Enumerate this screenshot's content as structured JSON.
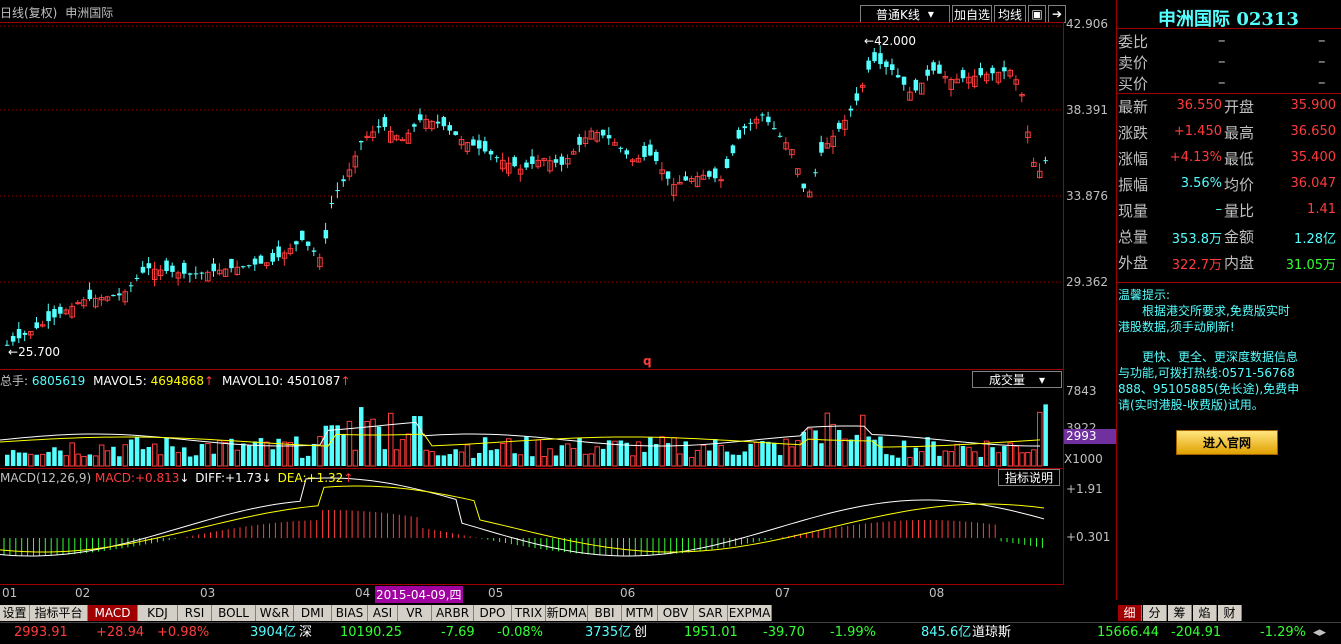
{
  "header": {
    "chart_title": "日线(复权)",
    "stock_name": "申洲国际",
    "kline_type": "普通K线",
    "add_watch": "加自选",
    "ma_line": "均线"
  },
  "price_axis": [
    "42.906",
    "38.391",
    "33.876",
    "29.362"
  ],
  "price_marks": {
    "high": "42.000",
    "low": "25.700"
  },
  "volume_pane": {
    "legend_prefix": "总手:",
    "total": "6805619",
    "mavol5_label": "MAVOL5:",
    "mavol5": "4694868",
    "mavol10_label": "MAVOL10:",
    "mavol10": "4501087",
    "dropdown": "成交量",
    "axis_top": "7843",
    "axis_mid": "3922",
    "axis_tag": "2993",
    "axis_unit": "X1000"
  },
  "macd_pane": {
    "legend_prefix": "MACD(12,26,9)",
    "macd_label": "MACD:",
    "macd": "+0.813",
    "diff_label": "DIFF:",
    "diff": "+1.73",
    "dea_label": "DEA:",
    "dea": "+1.32",
    "help_button": "指标说明",
    "axis_top": "+1.91",
    "axis_mid": "+0.301"
  },
  "x_axis": {
    "months": [
      "01",
      "02",
      "03",
      "04",
      "05",
      "06",
      "07",
      "08"
    ],
    "cursor_date": "2015-04-09,四"
  },
  "center_marker": "q",
  "indicator_tabs": [
    "设置",
    "指标平台",
    "MACD",
    "KDJ",
    "RSI",
    "BOLL",
    "W&R",
    "DMI",
    "BIAS",
    "ASI",
    "VR",
    "ARBR",
    "DPO",
    "TRIX",
    "新DMA",
    "BBI",
    "MTM",
    "OBV",
    "SAR",
    "EXPMA"
  ],
  "active_tab": "MACD",
  "right_tabs": [
    "细",
    "分",
    "筹",
    "焰",
    "财"
  ],
  "quote_panel": {
    "title": "申洲国际 02313",
    "weibi_label": "委比",
    "weibi": "–",
    "weibi2": "–",
    "sell_label": "卖价",
    "sell": "–",
    "sell2": "–",
    "buy_label": "买价",
    "buy": "–",
    "buy2": "–",
    "rows": [
      {
        "l1": "最新",
        "v1": "36.550",
        "c1": "red",
        "l2": "开盘",
        "v2": "35.900",
        "c2": "red"
      },
      {
        "l1": "涨跌",
        "v1": "+1.450",
        "c1": "red",
        "l2": "最高",
        "v2": "36.650",
        "c2": "red"
      },
      {
        "l1": "涨幅",
        "v1": "+4.13%",
        "c1": "red",
        "l2": "最低",
        "v2": "35.400",
        "c2": "red"
      },
      {
        "l1": "振幅",
        "v1": "3.56%",
        "c1": "cyan",
        "l2": "均价",
        "v2": "36.047",
        "c2": "red"
      },
      {
        "l1": "现量",
        "v1": "–",
        "c1": "cyan",
        "l2": "量比",
        "v2": "1.41",
        "c2": "red"
      },
      {
        "l1": "总量",
        "v1": "353.8万",
        "c1": "cyan",
        "l2": "金额",
        "v2": "1.28亿",
        "c2": "cyan"
      },
      {
        "l1": "外盘",
        "v1": "322.7万",
        "c1": "red",
        "l2": "内盘",
        "v2": "31.05万",
        "c2": "green"
      }
    ],
    "tip_title": "温馨提示:",
    "tip_line1": "根据港交所要求,免费版实时",
    "tip_line2": "港股数据,须手动刷新!",
    "tip_line3": "更快、更全、更深度数据信息",
    "tip_line4": "与功能,可拨打热线:0571-56768",
    "tip_line5": "888、95105885(免长途),免费申",
    "tip_line6": "请(实时港股-收费版)试用。",
    "enter_button": "进入官网"
  },
  "status_bar": {
    "sh_index": "2993.91",
    "sh_change": "+28.94",
    "sh_pct": "+0.98%",
    "sh_amount": "3904亿",
    "sz_label": "深",
    "sz_index": "10190.25",
    "sz_change": "-7.69",
    "sz_pct": "-0.08%",
    "sz_amount": "3735亿",
    "cy_label": "创",
    "cy_index": "1951.01",
    "cy_change": "-39.70",
    "cy_pct": "-1.99%",
    "dj_amount": "845.6亿",
    "dj_label": "道琼斯",
    "dj_index": "15666.44",
    "dj_change": "-204.91",
    "dj_pct": "-1.29%"
  },
  "colors": {
    "up": "#ff3c3c",
    "down": "#54ffff",
    "border": "#a00000",
    "ma5": "#ffffff",
    "ma10": "#ffff00"
  }
}
